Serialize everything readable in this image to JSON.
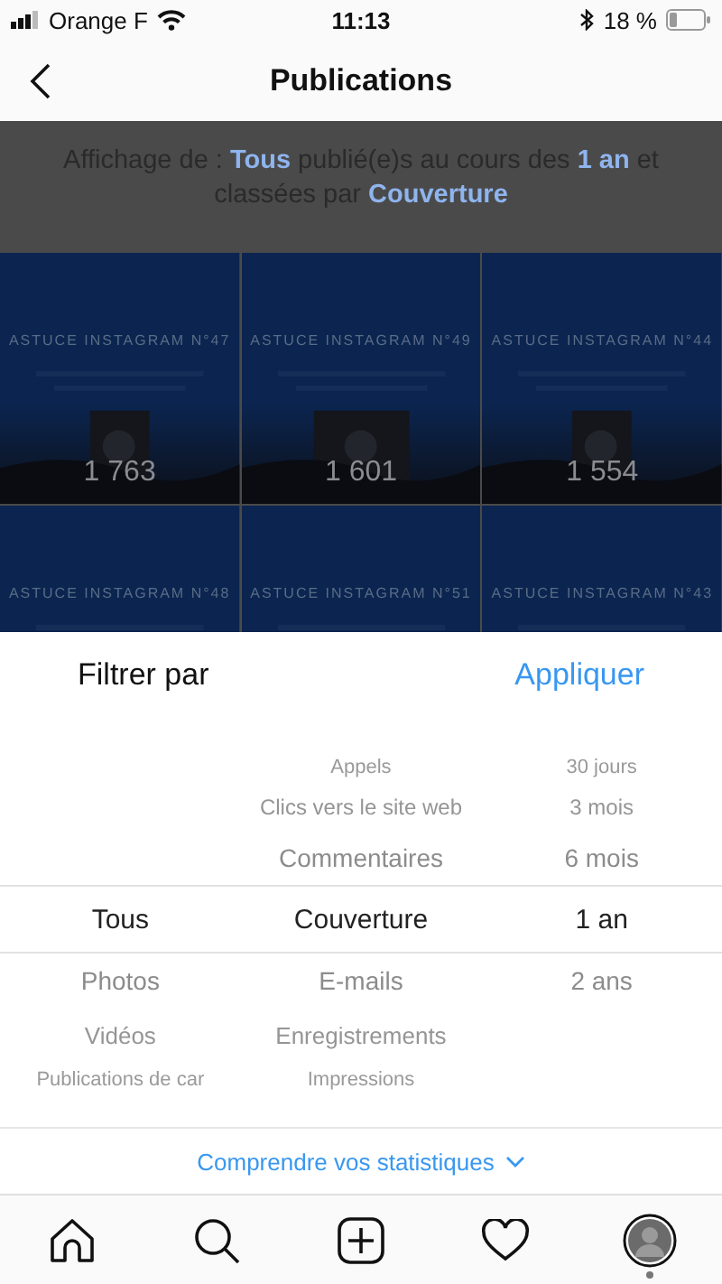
{
  "status_bar": {
    "carrier": "Orange F",
    "time": "11:13",
    "battery": "18 %"
  },
  "nav": {
    "title": "Publications"
  },
  "summary": "Affichage de : **Tous** publié(e)s au cours des **1 an** et classées par **Couverture**",
  "posts": [
    {
      "title": "ASTUCE INSTAGRAM N°47",
      "count": "1 763"
    },
    {
      "title": "ASTUCE INSTAGRAM N°49",
      "count": "1 601"
    },
    {
      "title": "ASTUCE INSTAGRAM N°44",
      "count": "1 554"
    },
    {
      "title": "ASTUCE INSTAGRAM N°48"
    },
    {
      "title": "ASTUCE INSTAGRAM N°51"
    },
    {
      "title": "ASTUCE INSTAGRAM N°43"
    }
  ],
  "filter": {
    "title": "Filtrer par",
    "apply": "Appliquer"
  },
  "picker": [
    {
      "items": [
        {
          "label": "Tous",
          "selected": true
        },
        {
          "label": "Photos",
          "selected": false
        },
        {
          "label": "Vidéos",
          "selected": false
        },
        {
          "label": "Publications de car",
          "selected": false
        }
      ]
    },
    {
      "items": [
        {
          "label": "Appels",
          "selected": false
        },
        {
          "label": "Clics vers le site web",
          "selected": false
        },
        {
          "label": "Commentaires",
          "selected": false
        },
        {
          "label": "Couverture",
          "selected": true
        },
        {
          "label": "E-mails",
          "selected": false
        },
        {
          "label": "Enregistrements",
          "selected": false
        },
        {
          "label": "Impressions",
          "selected": false
        }
      ]
    },
    {
      "items": [
        {
          "label": "30 jours",
          "selected": false
        },
        {
          "label": "3 mois",
          "selected": false
        },
        {
          "label": "6 mois",
          "selected": false
        },
        {
          "label": "1 an",
          "selected": true
        },
        {
          "label": "2 ans",
          "selected": false
        }
      ]
    }
  ],
  "help_link": "Comprendre vos statistiques",
  "tabs": [
    {
      "kind": "home",
      "selected": false
    },
    {
      "kind": "search",
      "selected": false
    },
    {
      "kind": "add",
      "selected": false
    },
    {
      "kind": "activity",
      "selected": false
    },
    {
      "kind": "profile",
      "selected": true
    }
  ]
}
